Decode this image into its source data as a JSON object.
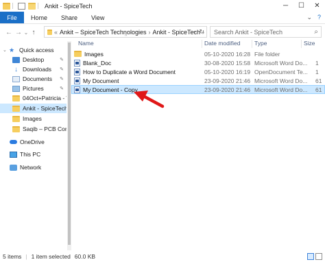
{
  "window": {
    "title": "Ankit - SpiceTech",
    "minimize": "─",
    "maximize": "☐",
    "close": "✕"
  },
  "ribbon": {
    "tabs": [
      "File",
      "Home",
      "Share",
      "View"
    ],
    "collapse_glyph": "⌄",
    "help_glyph": "?"
  },
  "address": {
    "back": "←",
    "forward": "→",
    "recent": "⌄",
    "up": "↑",
    "overflow": "«",
    "crumbs": [
      "Ankit – SpiceTech Technologies",
      "Ankit - SpiceTech"
    ],
    "separator": "›",
    "dropdown": "⌄",
    "refresh": "↻"
  },
  "search": {
    "placeholder": "Search Ankit - SpiceTech",
    "icon": "search-icon"
  },
  "nav": {
    "items": [
      {
        "label": "Quick access",
        "icon": "star-icon",
        "pinned": false
      },
      {
        "label": "Desktop",
        "icon": "desktop-icon",
        "pinned": true
      },
      {
        "label": "Downloads",
        "icon": "download-icon",
        "pinned": true
      },
      {
        "label": "Documents",
        "icon": "documents-icon",
        "pinned": true
      },
      {
        "label": "Pictures",
        "icon": "pictures-icon",
        "pinned": true
      },
      {
        "label": "04Oct+Patricia - WI",
        "icon": "folder-icon",
        "pinned": false
      },
      {
        "label": "Ankit - SpiceTech",
        "icon": "folder-icon",
        "pinned": false
      },
      {
        "label": "Images",
        "icon": "folder-icon",
        "pinned": false
      },
      {
        "label": "Saqib – PCB Compa",
        "icon": "folder-icon",
        "pinned": false
      },
      {
        "label": "OneDrive",
        "icon": "cloud-icon",
        "pinned": false
      },
      {
        "label": "This PC",
        "icon": "pc-icon",
        "pinned": false
      },
      {
        "label": "Network",
        "icon": "network-icon",
        "pinned": false
      }
    ],
    "pin_glyph": "📌",
    "selected_index": 6
  },
  "columns": {
    "name": "Name",
    "date": "Date modified",
    "type": "Type",
    "size": "Size",
    "sort_glyph": "^"
  },
  "files": [
    {
      "name": "Images",
      "date": "05-10-2020 16:28",
      "type": "File folder",
      "size": "",
      "icon": "folder-icon"
    },
    {
      "name": "Blank_Doc",
      "date": "30-08-2020 15:58",
      "type": "Microsoft Word Do...",
      "size": "1",
      "icon": "word-document-icon"
    },
    {
      "name": "How to Duplicate a Word Document",
      "date": "05-10-2020 16:19",
      "type": "OpenDocument Te...",
      "size": "1",
      "icon": "word-document-icon"
    },
    {
      "name": "My Document",
      "date": "23-09-2020 21:46",
      "type": "Microsoft Word Do...",
      "size": "61",
      "icon": "word-document-icon"
    },
    {
      "name": "My Document - Copy",
      "date": "23-09-2020 21:46",
      "type": "Microsoft Word Do...",
      "size": "61",
      "icon": "word-document-icon"
    }
  ],
  "selected_file_index": 4,
  "annotation": {
    "color": "#e01818"
  },
  "status": {
    "items": "5 items",
    "selected": "1 item selected",
    "size": "60.0 KB"
  },
  "colors": {
    "accent": "#1a6fc7",
    "selection": "#cce8ff"
  }
}
